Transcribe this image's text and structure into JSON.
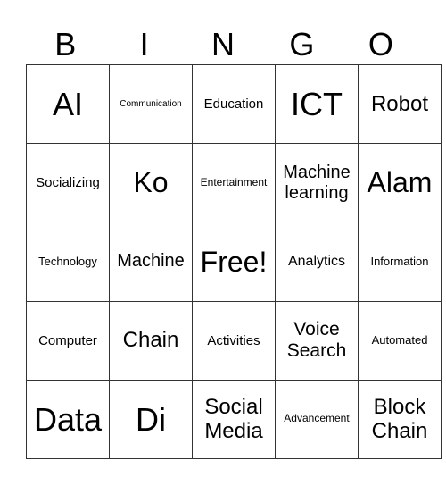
{
  "header": [
    "B",
    "I",
    "N",
    "G",
    "O"
  ],
  "rows": [
    [
      "AI",
      "Communication",
      "Education",
      "ICT",
      "Robot"
    ],
    [
      "Socializing",
      "Ko",
      "Entertainment",
      "Machine learning",
      "Alam"
    ],
    [
      "Technology",
      "Machine",
      "Free!",
      "Analytics",
      "Information"
    ],
    [
      "Computer",
      "Chain",
      "Activities",
      "Voice Search",
      "Automated"
    ],
    [
      "Data",
      "Di",
      "Social Media",
      "Advancement",
      "Block Chain"
    ]
  ]
}
